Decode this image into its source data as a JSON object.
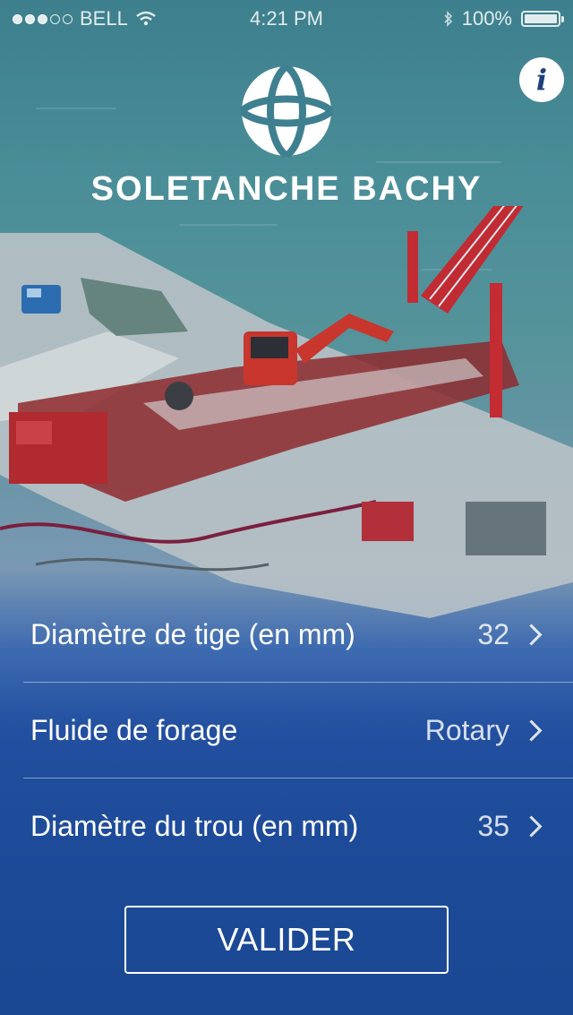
{
  "status_bar": {
    "carrier": "BELL",
    "time": "4:21 PM",
    "battery": "100%"
  },
  "header": {
    "brand": "SOLETANCHE BACHY",
    "info_label": "i"
  },
  "settings": [
    {
      "label": "Diamètre de tige (en mm)",
      "value": "32"
    },
    {
      "label": "Fluide de forage",
      "value": "Rotary"
    },
    {
      "label": "Diamètre du trou (en mm)",
      "value": "35"
    }
  ],
  "actions": {
    "validate_label": "VALIDER"
  }
}
